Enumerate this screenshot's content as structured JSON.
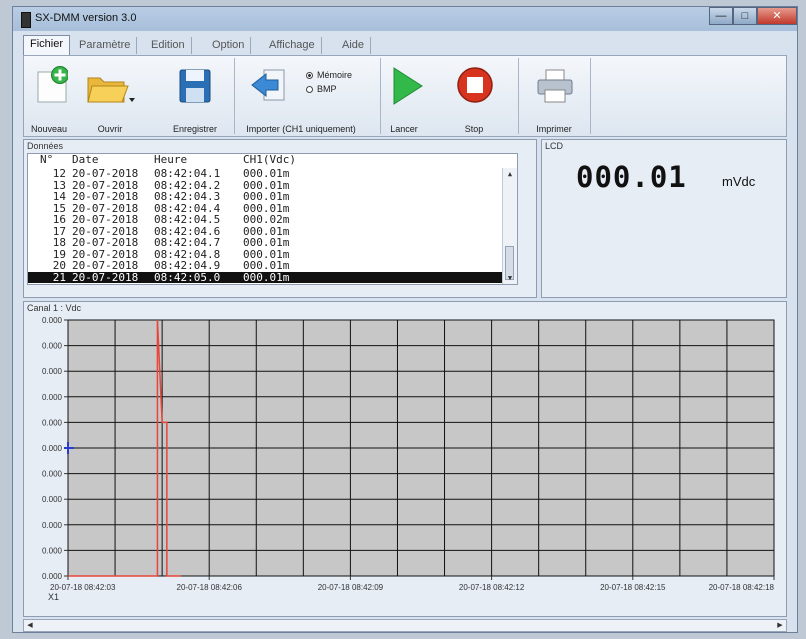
{
  "window": {
    "title": "SX-DMM version 3.0",
    "controls": {
      "minimize": "—",
      "maximize": "□",
      "close": "✕"
    }
  },
  "menu_tabs": [
    "Fichier",
    "Paramètre",
    "Edition",
    "Option",
    "Affichage",
    "Aide"
  ],
  "toolbar": {
    "nouveau": "Nouveau",
    "ouvrir": "Ouvrir",
    "enregistrer": "Enregistrer",
    "importer": "Importer (CH1 uniquement)",
    "memoire": "Mémoire",
    "bmp": "BMP",
    "lancer": "Lancer",
    "stop": "Stop",
    "imprimer": "Imprimer"
  },
  "data_panel": {
    "title": "Données",
    "headers": [
      "N°",
      "Date",
      "Heure",
      "CH1(Vdc)"
    ],
    "rows": [
      [
        "12",
        "20-07-2018",
        "08:42:04.1",
        "000.01m"
      ],
      [
        "13",
        "20-07-2018",
        "08:42:04.2",
        "000.01m"
      ],
      [
        "14",
        "20-07-2018",
        "08:42:04.3",
        "000.01m"
      ],
      [
        "15",
        "20-07-2018",
        "08:42:04.4",
        "000.01m"
      ],
      [
        "16",
        "20-07-2018",
        "08:42:04.5",
        "000.02m"
      ],
      [
        "17",
        "20-07-2018",
        "08:42:04.6",
        "000.01m"
      ],
      [
        "18",
        "20-07-2018",
        "08:42:04.7",
        "000.01m"
      ],
      [
        "19",
        "20-07-2018",
        "08:42:04.8",
        "000.01m"
      ],
      [
        "20",
        "20-07-2018",
        "08:42:04.9",
        "000.01m"
      ],
      [
        "21",
        "20-07-2018",
        "08:42:05.0",
        "000.01m"
      ]
    ],
    "selected_row": 9
  },
  "lcd": {
    "title": "LCD",
    "value": "000.01",
    "unit": "mVdc"
  },
  "chart_data": {
    "type": "line",
    "title": "Canal 1 : Vdc",
    "y_ticks": [
      "0.000",
      "0.000",
      "0.000",
      "0.000",
      "0.000",
      "0.000",
      "0.000",
      "0.000",
      "0.000",
      "0.000",
      "0.000"
    ],
    "x_ticks": [
      "20-07-18 08:42:03",
      "20-07-18 08:42:06",
      "20-07-18 08:42:09",
      "20-07-18 08:42:12",
      "20-07-18 08:42:15",
      "20-07-18 08:42:18"
    ],
    "x_range": [
      3.0,
      18.0
    ],
    "y_range": [
      0,
      1
    ],
    "x_axis_name": "X1",
    "grid": true,
    "series": [
      {
        "color": "#e8463a",
        "x": [
          3.0,
          4.9,
          4.9,
          5.0,
          5.1,
          5.1,
          5.4
        ],
        "y": [
          0,
          0,
          1,
          0.6,
          0.6,
          0,
          0
        ]
      }
    ]
  },
  "colors": {
    "plot_bg": "#c7c7c7",
    "grid": "#111111",
    "series": "#e8463a",
    "lancer_green": "#32b94a",
    "stop_red": "#d6341f"
  }
}
